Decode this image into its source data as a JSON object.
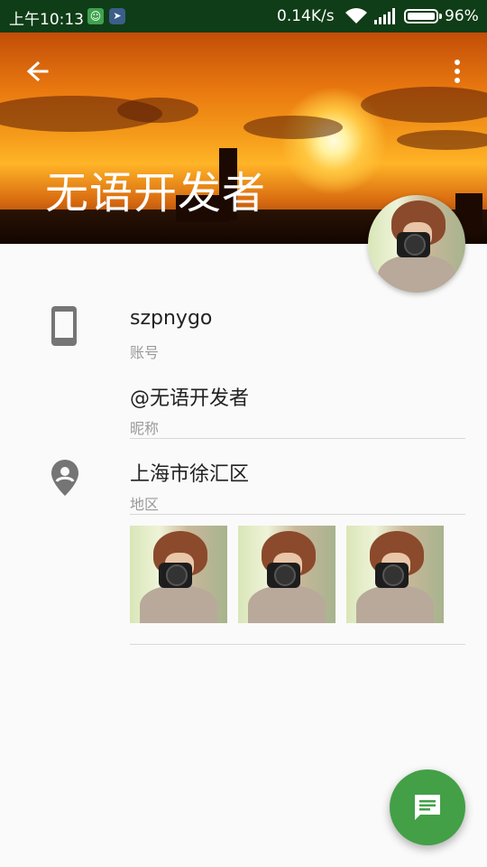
{
  "status_bar": {
    "time": "上午10:13",
    "speed": "0.14K/s",
    "battery": "96%"
  },
  "header": {
    "title": "无语开发者",
    "back_icon": "arrow-back-icon",
    "more_icon": "more-vert-icon"
  },
  "profile": {
    "account": {
      "value": "szpnygo",
      "label": "账号",
      "icon": "phone-icon"
    },
    "nickname": {
      "value": "@无语开发者",
      "label": "昵称"
    },
    "region": {
      "value": "上海市徐汇区",
      "label": "地区",
      "icon": "location-pin-icon"
    },
    "photos": [
      "photo-1",
      "photo-2",
      "photo-3"
    ]
  },
  "fab": {
    "icon": "chat-icon"
  },
  "colors": {
    "status_bar": "#0f3d17",
    "fab": "#43a047",
    "icon_gray": "#757575",
    "label_gray": "#9a9a9a"
  }
}
